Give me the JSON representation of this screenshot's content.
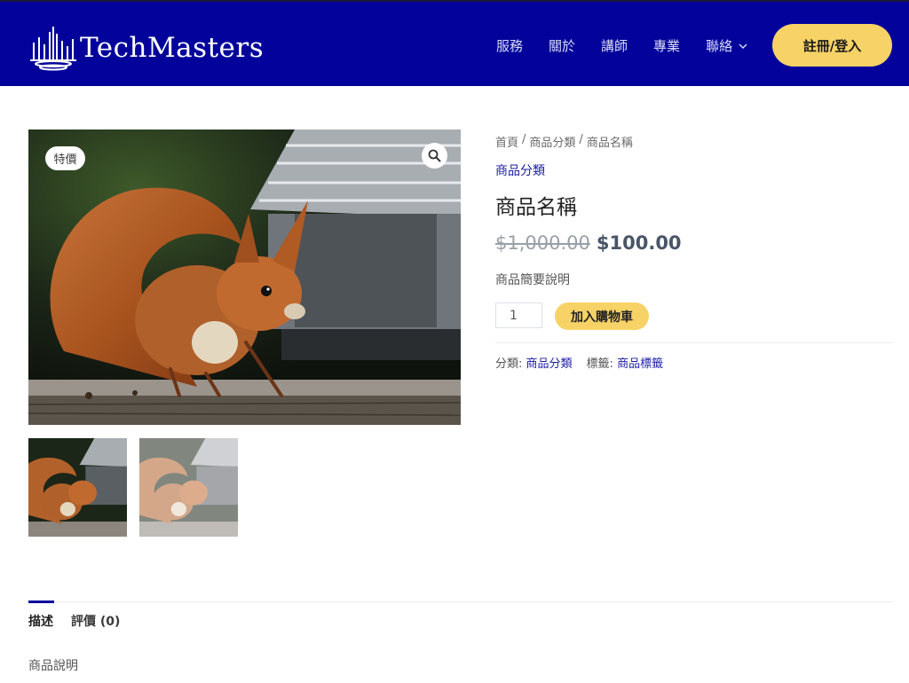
{
  "header": {
    "brand": "TechMasters",
    "nav": [
      {
        "label": "服務"
      },
      {
        "label": "關於"
      },
      {
        "label": "講師"
      },
      {
        "label": "專業"
      },
      {
        "label": "聯絡",
        "has_dropdown": true
      }
    ],
    "cta_label": "註冊/登入",
    "colors": {
      "header_bg": "#03039c",
      "accent": "#f7d266",
      "link": "#1c1ca6"
    }
  },
  "product": {
    "sale_badge": "特價",
    "zoom_icon": "magnifier-icon",
    "breadcrumb": [
      "首頁",
      "商品分類",
      "商品名稱"
    ],
    "breadcrumb_separator": "/",
    "category_link": "商品分類",
    "title": "商品名稱",
    "regular_price": "$1,000.00",
    "sale_price": "$100.00",
    "short_description": "商品簡要說明",
    "quantity": "1",
    "add_to_cart_label": "加入購物車",
    "meta": {
      "category_label": "分類:",
      "category_value": "商品分類",
      "tag_label": "標籤:",
      "tag_value": "商品標籤"
    },
    "image_subject": "red squirrel photo",
    "thumbnails": 2
  },
  "tabs": [
    {
      "label": "描述",
      "active": true
    },
    {
      "label": "評價 (0)",
      "active": false
    }
  ],
  "description": "商品說明"
}
